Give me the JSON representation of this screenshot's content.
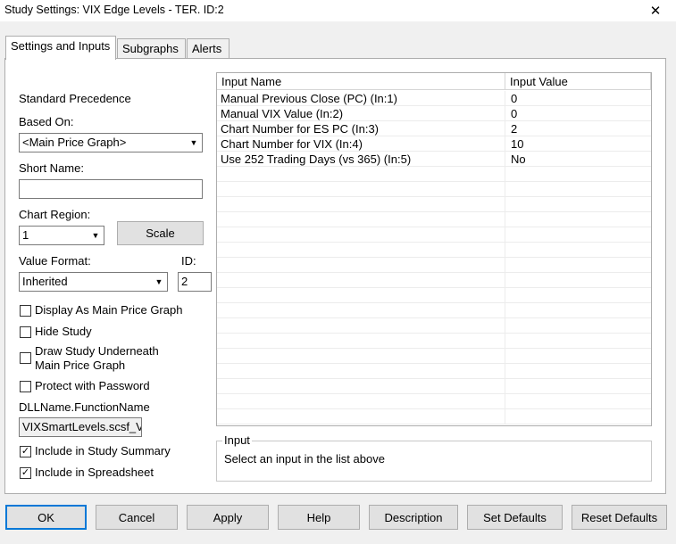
{
  "window": {
    "title": "Study Settings: VIX Edge Levels - TER. ID:2",
    "close_glyph": "✕"
  },
  "tabs": [
    {
      "label": "Settings and Inputs",
      "active": true
    },
    {
      "label": "Subgraphs",
      "active": false
    },
    {
      "label": "Alerts",
      "active": false
    }
  ],
  "settings": {
    "standard_precedence": "Standard Precedence",
    "based_on_label": "Based On:",
    "based_on_value": "<Main Price Graph>",
    "short_name_label": "Short Name:",
    "short_name_value": "",
    "chart_region_label": "Chart Region:",
    "chart_region_value": "1",
    "scale_button": "Scale",
    "value_format_label": "Value Format:",
    "value_format_value": "Inherited",
    "id_label": "ID:",
    "id_value": "2",
    "checkboxes": [
      {
        "label": "Display As Main Price Graph",
        "checked": false
      },
      {
        "label": "Hide Study",
        "checked": false
      },
      {
        "label": "Draw Study Underneath",
        "label2": "Main Price Graph",
        "checked": false
      },
      {
        "label": "Protect with Password",
        "checked": false
      }
    ],
    "dll_label": "DLLName.FunctionName",
    "dll_value": "VIXSmartLevels.scsf_V",
    "include_summary": {
      "label": "Include in Study Summary",
      "checked": true
    },
    "include_spreadsheet": {
      "label": "Include in Spreadsheet",
      "checked": true
    },
    "check_glyph": "✓",
    "arrow_glyph": "▼"
  },
  "inputs_grid": {
    "headers": [
      "Input Name",
      "Input Value"
    ],
    "rows": [
      {
        "name": "Manual Previous Close (PC)   (In:1)",
        "value": "0"
      },
      {
        "name": "Manual VIX Value   (In:2)",
        "value": "0"
      },
      {
        "name": "Chart Number for ES PC   (In:3)",
        "value": "2"
      },
      {
        "name": "Chart Number for VIX   (In:4)",
        "value": "10"
      },
      {
        "name": "Use 252 Trading Days (vs 365)   (In:5)",
        "value": "No"
      }
    ]
  },
  "input_group": {
    "title": "Input",
    "hint": "Select an input in the list above"
  },
  "buttons": {
    "ok": "OK",
    "cancel": "Cancel",
    "apply": "Apply",
    "help": "Help",
    "description": "Description",
    "set_defaults": "Set Defaults",
    "reset_defaults": "Reset Defaults"
  }
}
